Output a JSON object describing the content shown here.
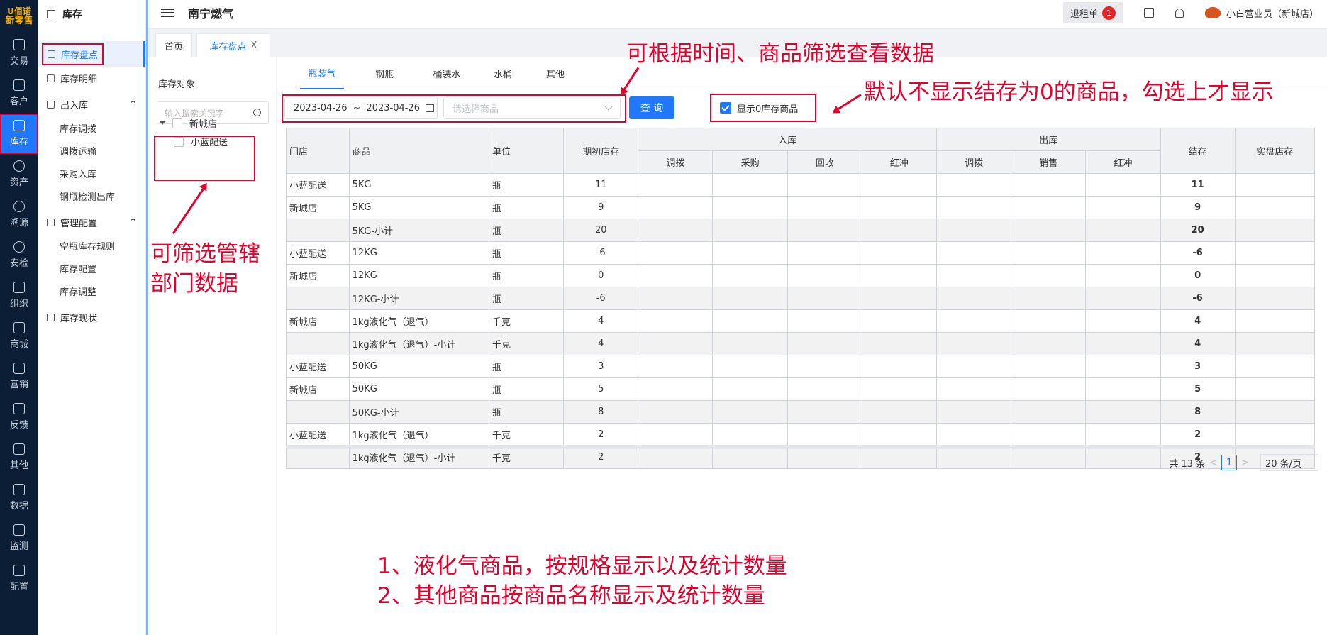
{
  "rail": {
    "brand_line1": "U佰诺",
    "brand_line2": "新零售",
    "items": [
      {
        "label": "交易"
      },
      {
        "label": "客户"
      },
      {
        "label": "库存"
      },
      {
        "label": "资产"
      },
      {
        "label": "溯源"
      },
      {
        "label": "安检"
      },
      {
        "label": "组织"
      },
      {
        "label": "商城"
      },
      {
        "label": "营销"
      },
      {
        "label": "反馈"
      },
      {
        "label": "其他"
      },
      {
        "label": "数据"
      },
      {
        "label": "监测"
      },
      {
        "label": "配置"
      }
    ]
  },
  "menu": {
    "title": "库存",
    "active_item": "库存盘点",
    "item_detail": "库存明细",
    "group_inout": "出入库",
    "inout_items": [
      "库存调拨",
      "调拨运输",
      "采购入库",
      "钢瓶检测出库"
    ],
    "group_config": "管理配置",
    "config_items": [
      "空瓶库存规则",
      "库存配置",
      "库存调整"
    ],
    "item_status": "库存现状"
  },
  "topbar": {
    "title": "南宁燃气",
    "return_label": "退租单",
    "return_badge": "1",
    "user": "小白营业员（新城店）"
  },
  "pagetabs": {
    "home": "首页",
    "current": "库存盘点",
    "close": "X"
  },
  "tree": {
    "title": "库存对象",
    "search_placeholder": "输入搜索关键字",
    "root": "新城店",
    "child": "小蓝配送"
  },
  "product_tabs": [
    "瓶装气",
    "钢瓶",
    "桶装水",
    "水桶",
    "其他"
  ],
  "filters": {
    "date_start": "2023-04-26",
    "date_sep": "~",
    "date_end": "2023-04-26",
    "goods_placeholder": "请选择商品",
    "query_button": "查 询",
    "show_zero_label": "显示0库存商品"
  },
  "table": {
    "headers": {
      "store": "门店",
      "goods": "商品",
      "unit": "单位",
      "opening": "期初店存",
      "in_group": "入库",
      "out_group": "出库",
      "closing": "结存",
      "actual": "实盘店存"
    },
    "in_subs": [
      "调拨",
      "采购",
      "回收",
      "红冲"
    ],
    "out_subs": [
      "调拨",
      "销售",
      "红冲"
    ],
    "rows": [
      {
        "store": "小蓝配送",
        "goods": "5KG",
        "unit": "瓶",
        "opening": "11",
        "closing": "11",
        "subtotal": false
      },
      {
        "store": "新城店",
        "goods": "5KG",
        "unit": "瓶",
        "opening": "9",
        "closing": "9",
        "subtotal": false
      },
      {
        "store": "",
        "goods": "5KG-小计",
        "unit": "瓶",
        "opening": "20",
        "closing": "20",
        "subtotal": true
      },
      {
        "store": "小蓝配送",
        "goods": "12KG",
        "unit": "瓶",
        "opening": "-6",
        "closing": "-6",
        "subtotal": false
      },
      {
        "store": "新城店",
        "goods": "12KG",
        "unit": "瓶",
        "opening": "0",
        "closing": "0",
        "subtotal": false
      },
      {
        "store": "",
        "goods": "12KG-小计",
        "unit": "瓶",
        "opening": "-6",
        "closing": "-6",
        "subtotal": true
      },
      {
        "store": "新城店",
        "goods": "1kg液化气（退气）",
        "unit": "千克",
        "opening": "4",
        "closing": "4",
        "subtotal": false
      },
      {
        "store": "",
        "goods": "1kg液化气（退气）-小计",
        "unit": "千克",
        "opening": "4",
        "closing": "4",
        "subtotal": true
      },
      {
        "store": "小蓝配送",
        "goods": "50KG",
        "unit": "瓶",
        "opening": "3",
        "closing": "3",
        "subtotal": false
      },
      {
        "store": "新城店",
        "goods": "50KG",
        "unit": "瓶",
        "opening": "5",
        "closing": "5",
        "subtotal": false
      },
      {
        "store": "",
        "goods": "50KG-小计",
        "unit": "瓶",
        "opening": "8",
        "closing": "8",
        "subtotal": true
      },
      {
        "store": "小蓝配送",
        "goods": "1kg液化气（退气）",
        "unit": "千克",
        "opening": "2",
        "closing": "2",
        "subtotal": false
      },
      {
        "store": "",
        "goods": "1kg液化气（退气）-小计",
        "unit": "千克",
        "opening": "2",
        "closing": "2",
        "subtotal": true
      }
    ]
  },
  "pager": {
    "total": "共 13 条",
    "prev": "<",
    "page": "1",
    "next": ">",
    "size": "20 条/页"
  },
  "annotations": {
    "filter_note": "可根据时间、商品筛选查看数据",
    "zero_note": "默认不显示结存为0的商品，勾选上才显示",
    "tree_note_1": "可筛选管辖",
    "tree_note_2": "部门数据",
    "bottom_note_1": "1、液化气商品，按规格显示以及统计数量",
    "bottom_note_2": "2、其他商品按商品名称显示及统计数量"
  },
  "colors": {
    "accent": "#1f78ff",
    "annotation": "#e4002b",
    "rail": "#0b1e36"
  }
}
